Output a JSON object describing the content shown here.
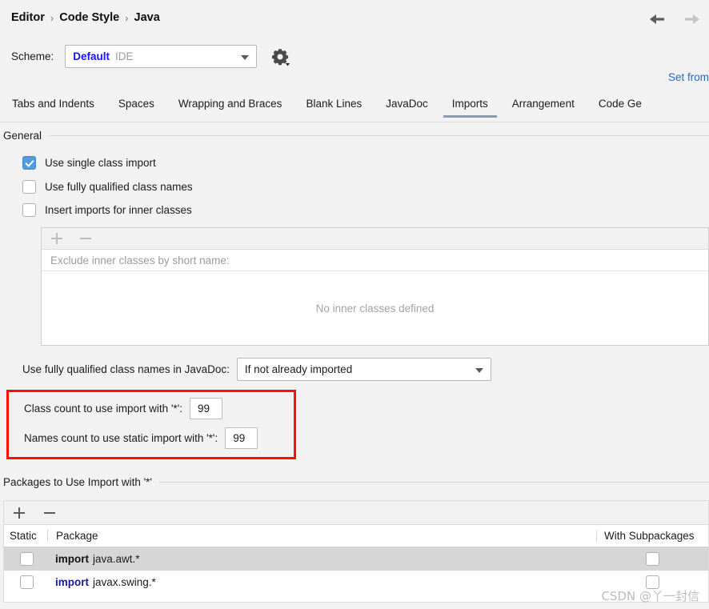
{
  "header": {
    "breadcrumb": [
      "Editor",
      "Code Style",
      "Java"
    ],
    "separator": "›",
    "back_icon": "arrow-left-icon",
    "forward_icon": "arrow-right-icon"
  },
  "scheme": {
    "label": "Scheme:",
    "name": "Default",
    "kind": "IDE",
    "gear_icon": "gear-icon",
    "name_color": "#1414f0",
    "kind_color": "#9a9a9a"
  },
  "set_from": {
    "label": "Set from",
    "color": "#2a6ab5"
  },
  "tabs": [
    {
      "label": "Tabs and Indents",
      "selected": false
    },
    {
      "label": "Spaces",
      "selected": false
    },
    {
      "label": "Wrapping and Braces",
      "selected": false
    },
    {
      "label": "Blank Lines",
      "selected": false
    },
    {
      "label": "JavaDoc",
      "selected": false
    },
    {
      "label": "Imports",
      "selected": true
    },
    {
      "label": "Arrangement",
      "selected": false
    },
    {
      "label": "Code Ge",
      "selected": false
    }
  ],
  "general": {
    "section_title": "General",
    "checkboxes": [
      {
        "label": "Use single class import",
        "checked": true
      },
      {
        "label": "Use fully qualified class names",
        "checked": false
      },
      {
        "label": "Insert imports for inner classes",
        "checked": false
      }
    ],
    "inner_panel": {
      "add_icon": "plus-icon",
      "remove_icon": "minus-icon",
      "header": "Exclude inner classes by short name:",
      "empty_text": "No inner classes defined"
    },
    "javadoc": {
      "label": "Use fully qualified class names in JavaDoc:",
      "value": "If not already imported"
    },
    "counts": [
      {
        "label": "Class count to use import with '*':",
        "value": "99"
      },
      {
        "label": "Names count to use static import with '*':",
        "value": "99"
      }
    ],
    "highlight_color": "#fb1100"
  },
  "packages": {
    "section_title": "Packages to Use Import with '*'",
    "add_icon": "plus-icon",
    "remove_icon": "minus-icon",
    "columns": [
      "Static",
      "Package",
      "With Subpackages"
    ],
    "rows": [
      {
        "static_checked": false,
        "keyword": "import",
        "package": "java.awt.*",
        "subpackages_checked": false,
        "selected": true
      },
      {
        "static_checked": false,
        "keyword": "import",
        "package": "javax.swing.*",
        "subpackages_checked": false,
        "selected": false
      }
    ]
  },
  "watermark": {
    "text": "CSDN @丫一封信"
  }
}
